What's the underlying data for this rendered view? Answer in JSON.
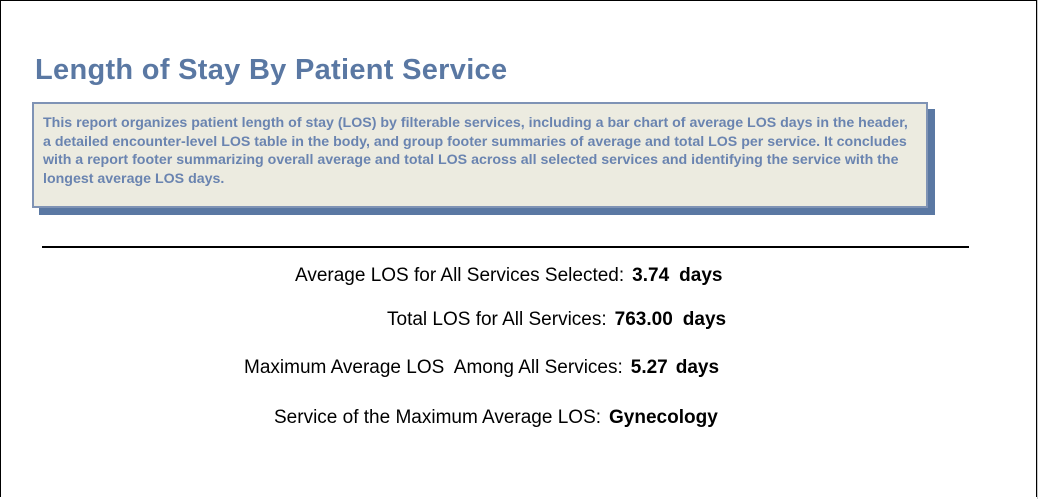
{
  "report": {
    "title": "Length of Stay By Patient Service",
    "description": "This report organizes patient length of stay (LOS) by filterable services, including a bar chart of average LOS days in the header, a detailed encounter-level LOS table in the body, and group footer summaries of average and total LOS per service. It concludes with a report footer summarizing overall average and total LOS across all selected services and identifying the service with the longest average LOS days."
  },
  "summary": {
    "avg_label": "Average LOS for All Services Selected:",
    "avg_value": "3.74",
    "avg_unit": "days",
    "total_label": "Total LOS for All Services:",
    "total_value": "763.00",
    "total_unit": "days",
    "max_label": "Maximum Average LOS  Among All Services:",
    "max_value": "5.27",
    "max_unit": "days",
    "svc_label": "Service of the Maximum Average LOS:",
    "svc_value": "Gynecology"
  },
  "colors": {
    "title": "#5a78a3",
    "desc_text": "#6a84b0",
    "desc_bg": "#ecebe0",
    "desc_shadow": "#5a78a3"
  }
}
